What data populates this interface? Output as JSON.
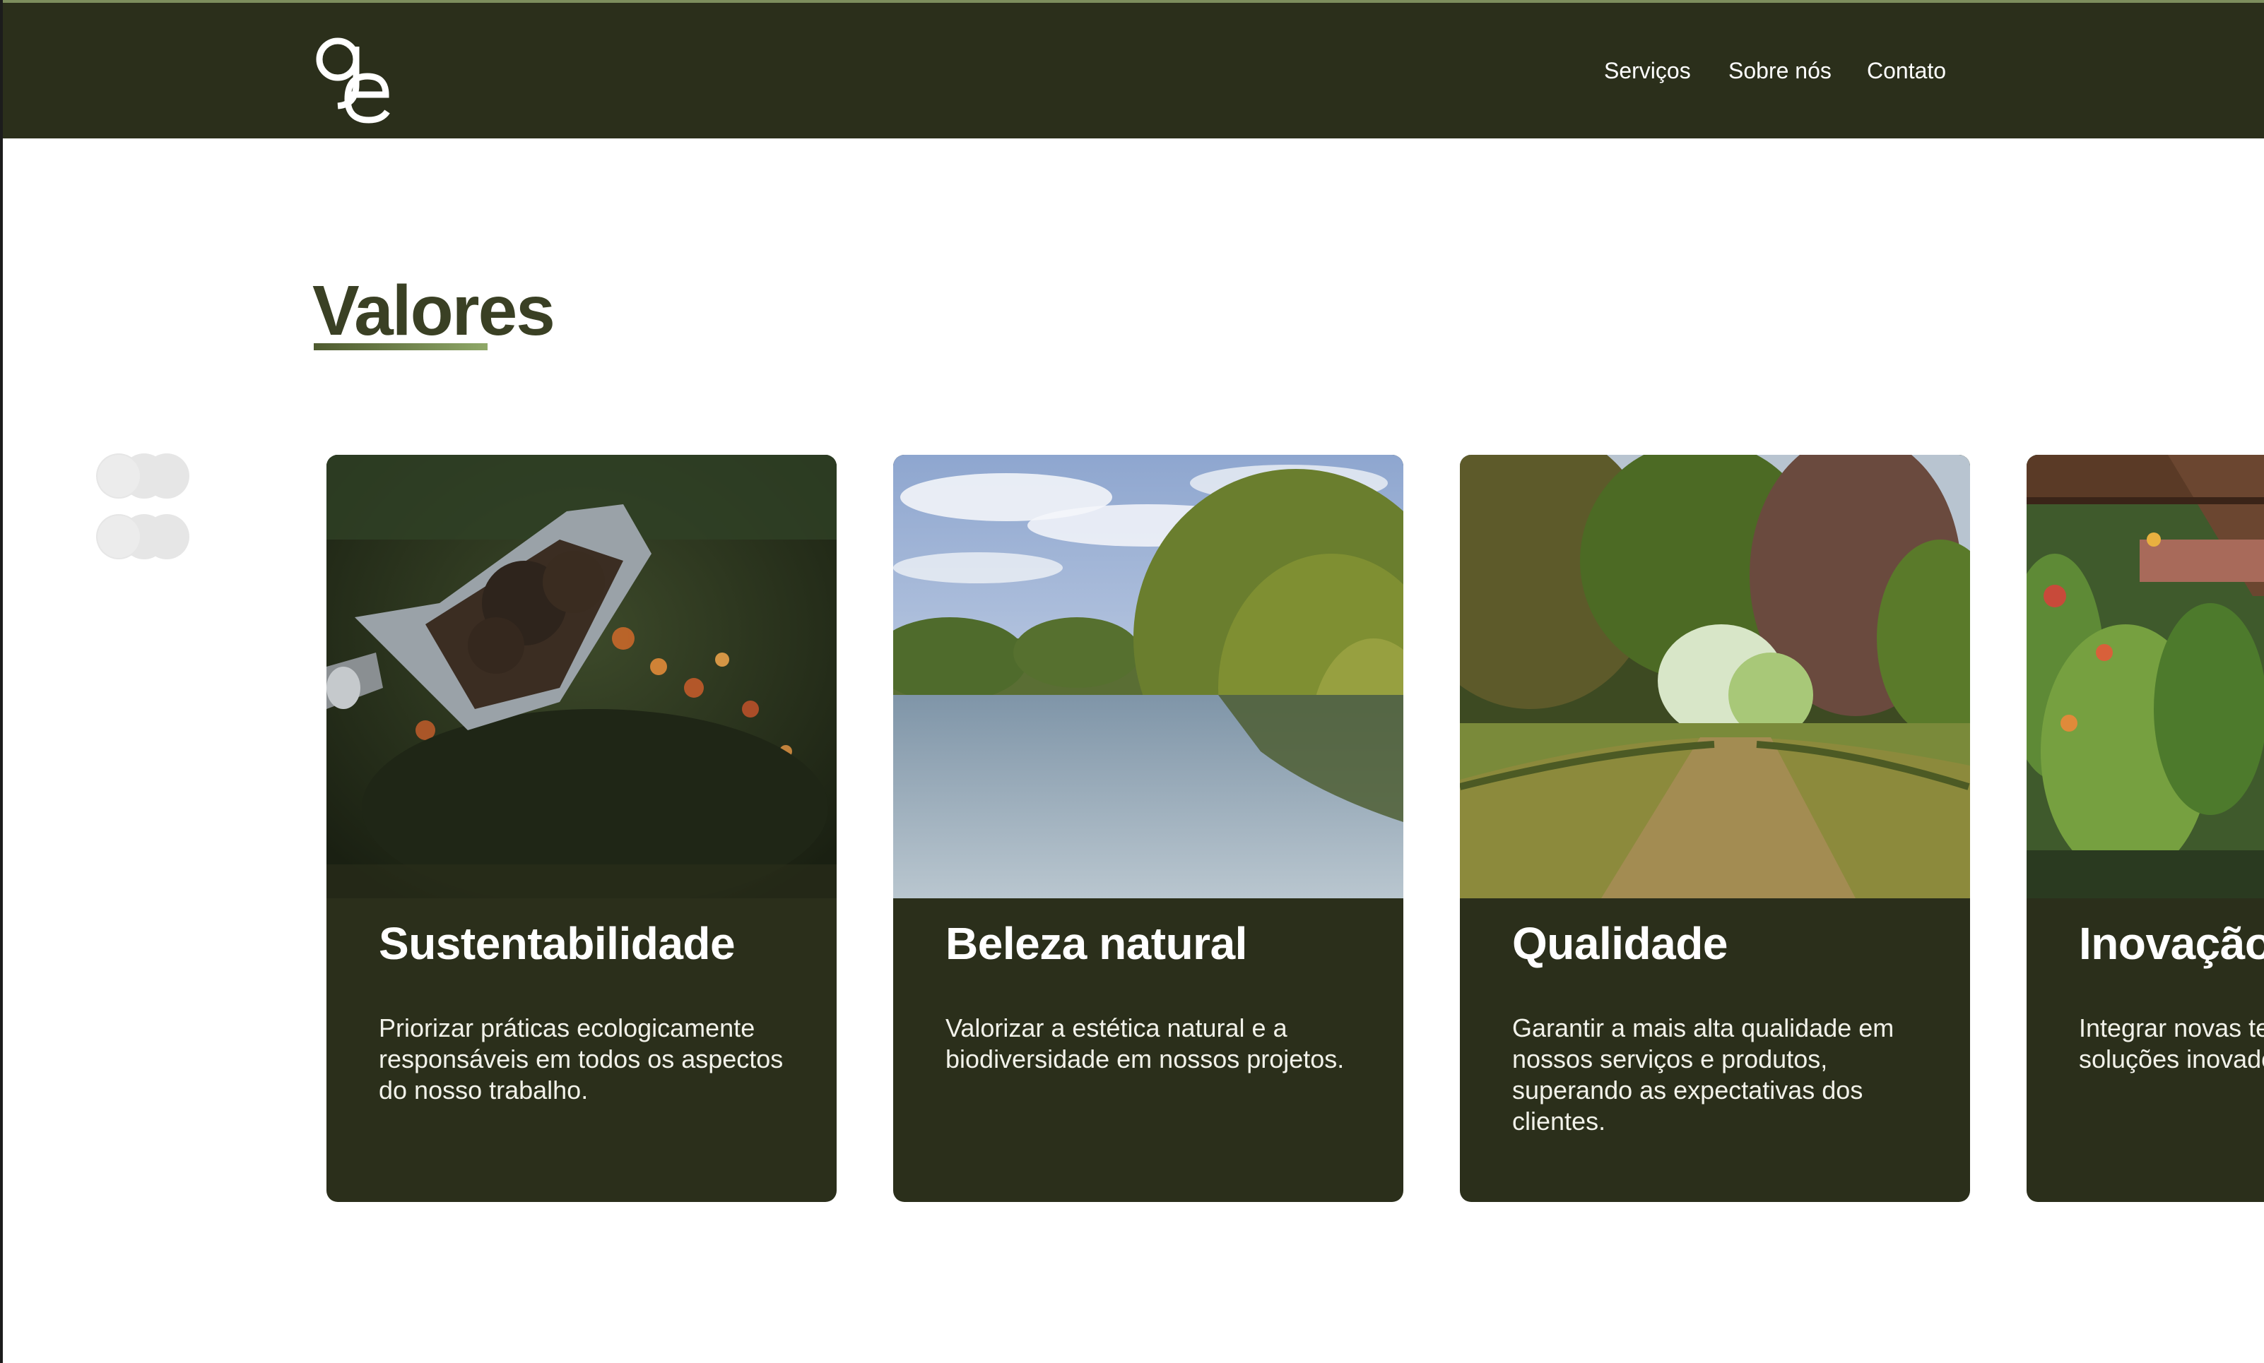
{
  "header": {
    "logo_text": "ge",
    "nav": [
      {
        "label": "Serviços"
      },
      {
        "label": "Sobre nós"
      },
      {
        "label": "Contato"
      }
    ]
  },
  "values_section": {
    "title": "Valores",
    "cards": [
      {
        "title": "Sustentabilidade",
        "text": "Priorizar práticas ecologicamente responsáveis em todos os aspectos do nosso trabalho.",
        "image": "garden-trowel-soil-photo"
      },
      {
        "title": "Beleza natural",
        "text": "Valorizar a estética natural e a biodiversidade em nossos projetos.",
        "image": "river-trees-landscape-photo"
      },
      {
        "title": "Qualidade",
        "text": "Garantir a mais alta qualidade em nossos serviços e produtos, superando as expectativas dos clientes.",
        "image": "park-path-trees-photo"
      },
      {
        "title": "Inovação",
        "text": "Integrar novas tecnologias para criar soluções inovadoras.",
        "image": "tropical-plants-pergola-photo"
      }
    ]
  },
  "colors": {
    "header_bg": "#2b2f1b",
    "card_bg": "#2b2f1b",
    "title_color": "#3a4024",
    "accent": "#8fa868"
  }
}
